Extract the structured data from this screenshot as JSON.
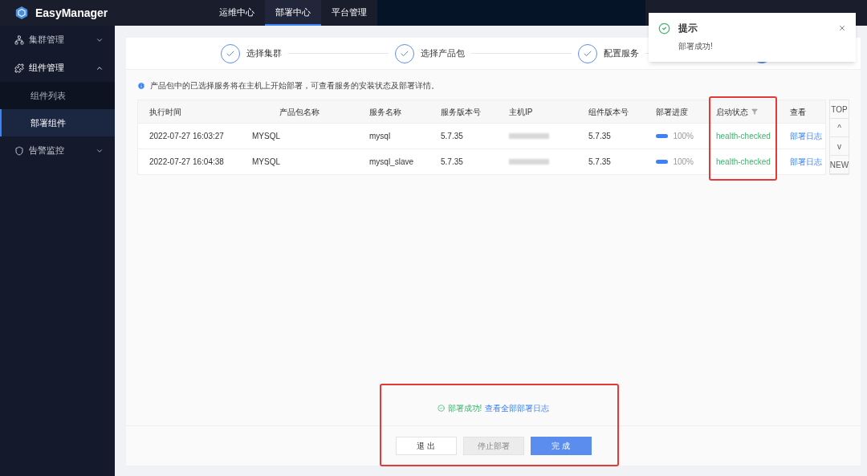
{
  "header": {
    "brand": "EasyManager",
    "nav": [
      {
        "label": "运维中心",
        "selected": false
      },
      {
        "label": "部署中心",
        "selected": true
      },
      {
        "label": "平台管理",
        "selected": false
      }
    ]
  },
  "sidebar": {
    "items": [
      {
        "kind": "cluster",
        "label": "集群管理",
        "expanded": false
      },
      {
        "kind": "component",
        "label": "组件管理",
        "expanded": true,
        "children": [
          {
            "label": "组件列表",
            "selected": false
          },
          {
            "label": "部署组件",
            "selected": true
          }
        ]
      },
      {
        "kind": "alarm",
        "label": "告警监控",
        "expanded": false
      }
    ]
  },
  "steps": [
    {
      "label": "选择集群",
      "done": true
    },
    {
      "label": "选择产品包",
      "done": true
    },
    {
      "label": "配置服务",
      "done": true
    },
    {
      "done": false
    }
  ],
  "info": "产品包中的已选择服务将在主机上开始部署，可查看服务的安装状态及部署详情。",
  "table": {
    "columns": [
      "执行时间",
      "产品包名称",
      "服务名称",
      "服务版本号",
      "主机IP",
      "组件版本号",
      "部署进度",
      "启动状态",
      "查看"
    ],
    "rows": [
      {
        "time": "2022-07-27 16:03:27",
        "package": "MYSQL",
        "service": "mysql",
        "service_version": "5.7.35",
        "component_version": "5.7.35",
        "level": 1,
        "progress": "100%",
        "status": "health-checked",
        "link": "部署日志"
      },
      {
        "time": "2022-07-27 16:04:38",
        "package": "MYSQL",
        "service": "mysql_slave",
        "service_version": "5.7.35",
        "component_version": "5.7.35",
        "level": 1,
        "progress": "100%",
        "status": "health-checked",
        "link": "部署日志"
      }
    ]
  },
  "scroll_buttons": [
    "TOP",
    "^",
    "v",
    "NEW"
  ],
  "footer": {
    "message": "部署成功!",
    "link": "查看全部部署日志",
    "buttons": [
      {
        "label": "退 出",
        "kind": "default",
        "disabled": false
      },
      {
        "label": "停止部署",
        "kind": "default",
        "disabled": true
      },
      {
        "label": "完 成",
        "kind": "primary",
        "disabled": false
      }
    ]
  },
  "toast": {
    "title": "提示",
    "message": "部署成功!"
  }
}
